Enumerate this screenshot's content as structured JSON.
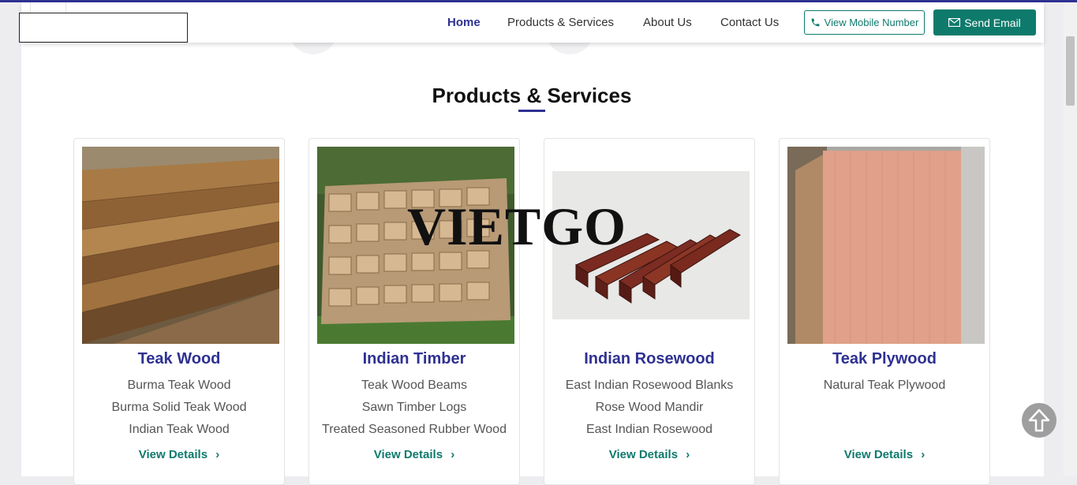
{
  "nav": {
    "items": [
      "Home",
      "Products & Services",
      "About Us",
      "Contact Us"
    ],
    "mobile_button": "View Mobile Number",
    "email_button": "Send Email"
  },
  "section": {
    "title": "Products & Services"
  },
  "watermark": "VIETGO",
  "products": [
    {
      "name": "Teak Wood",
      "items": [
        "Burma Teak Wood",
        "Burma Solid Teak Wood",
        "Indian Teak Wood"
      ],
      "link": "View Details"
    },
    {
      "name": "Indian Timber",
      "items": [
        "Teak Wood Beams",
        "Sawn Timber Logs",
        "Treated Seasoned Rubber Wood"
      ],
      "link": "View Details"
    },
    {
      "name": "Indian Rosewood",
      "items": [
        "East Indian Rosewood Blanks",
        "Rose Wood Mandir",
        "East Indian Rosewood"
      ],
      "link": "View Details"
    },
    {
      "name": "Teak Plywood",
      "items": [
        "Natural Teak Plywood"
      ],
      "link": "View Details"
    }
  ],
  "colors": {
    "brand": "#2e3192",
    "accent": "#0e7a6c"
  }
}
